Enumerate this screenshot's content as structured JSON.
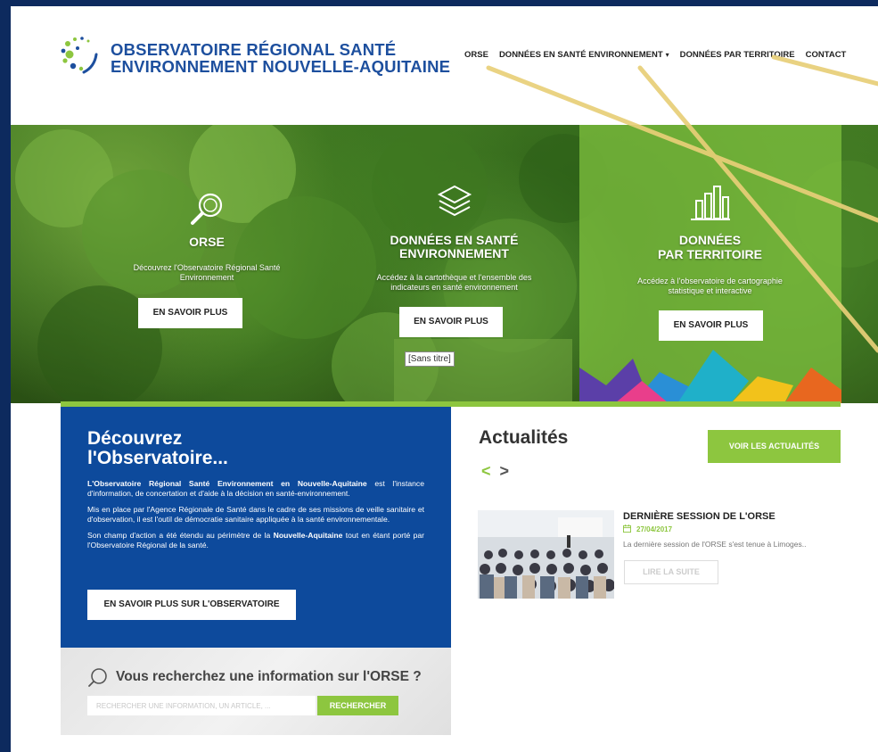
{
  "header": {
    "logo_line1": "OBSERVATOIRE RÉGIONAL SANTÉ",
    "logo_line2": "ENVIRONNEMENT NOUVELLE-AQUITAINE",
    "nav": [
      {
        "label": "ORSE"
      },
      {
        "label": "DONNÉES EN SANTÉ ENVIRONNEMENT",
        "has_dropdown": true
      },
      {
        "label": "DONNÉES PAR TERRITOIRE"
      },
      {
        "label": "CONTACT"
      }
    ],
    "dropdown_caret": "▾"
  },
  "hero": {
    "columns": [
      {
        "icon": "magnifier-icon",
        "title": "ORSE",
        "desc": "Découvrez l'Observatoire Régional Santé Environnement",
        "button": "EN SAVOIR PLUS"
      },
      {
        "icon": "layers-icon",
        "title_line1": "DONNÉES EN SANTÉ",
        "title_line2": "ENVIRONNEMENT",
        "desc": "Accédez à la cartothèque et l'ensemble des indicateurs en santé environnement",
        "button": "EN SAVOIR PLUS"
      },
      {
        "icon": "bar-chart-icon",
        "title_line1": "DONNÉES",
        "title_line2": "PAR TERRITOIRE",
        "desc": "Accédez à l'observatoire de cartographie statistique et interactive",
        "button": "EN SAVOIR PLUS"
      }
    ],
    "image_caption": "[Sans titre]"
  },
  "discover": {
    "title_line1": "Découvrez",
    "title_line2": "l'Observatoire...",
    "p1_bold": "L'Observatoire Régional Santé Environnement en Nouvelle-Aquitaine",
    "p1_rest": " est l'instance d'information, de concertation et d'aide à la décision en santé-environnement.",
    "p2": "Mis en place par l'Agence Régionale de Santé dans le cadre de ses missions de veille sanitaire et d'observation, il est l'outil de démocratie sanitaire appliquée à la santé environnementale.",
    "p3_start": "Son champ d'action a été étendu au périmètre de la ",
    "p3_bold": "Nouvelle-Aquitaine",
    "p3_end": " tout en étant porté par l'Observatoire Régional de la santé.",
    "button": "EN SAVOIR PLUS SUR L'OBSERVATOIRE"
  },
  "search": {
    "title": "Vous recherchez une information sur l'ORSE ?",
    "placeholder": "RECHERCHER UNE INFORMATION, UN ARTICLE, ...",
    "button": "RECHERCHER"
  },
  "news": {
    "title": "Actualités",
    "prev": "<",
    "next": ">",
    "all_button": "VOIR LES ACTUALITÉS",
    "item": {
      "title": "DERNIÈRE SESSION DE L'ORSE",
      "date": "27/04/2017",
      "excerpt": "La dernière session de l'ORSE s'est tenue à Limoges..",
      "more": "LIRE LA SUITE"
    }
  },
  "colors": {
    "brand_blue": "#0d4a9c",
    "accent_green": "#8dc63f",
    "frame": "#0d2a5e",
    "annotation_yellow": "#e8cf78"
  }
}
